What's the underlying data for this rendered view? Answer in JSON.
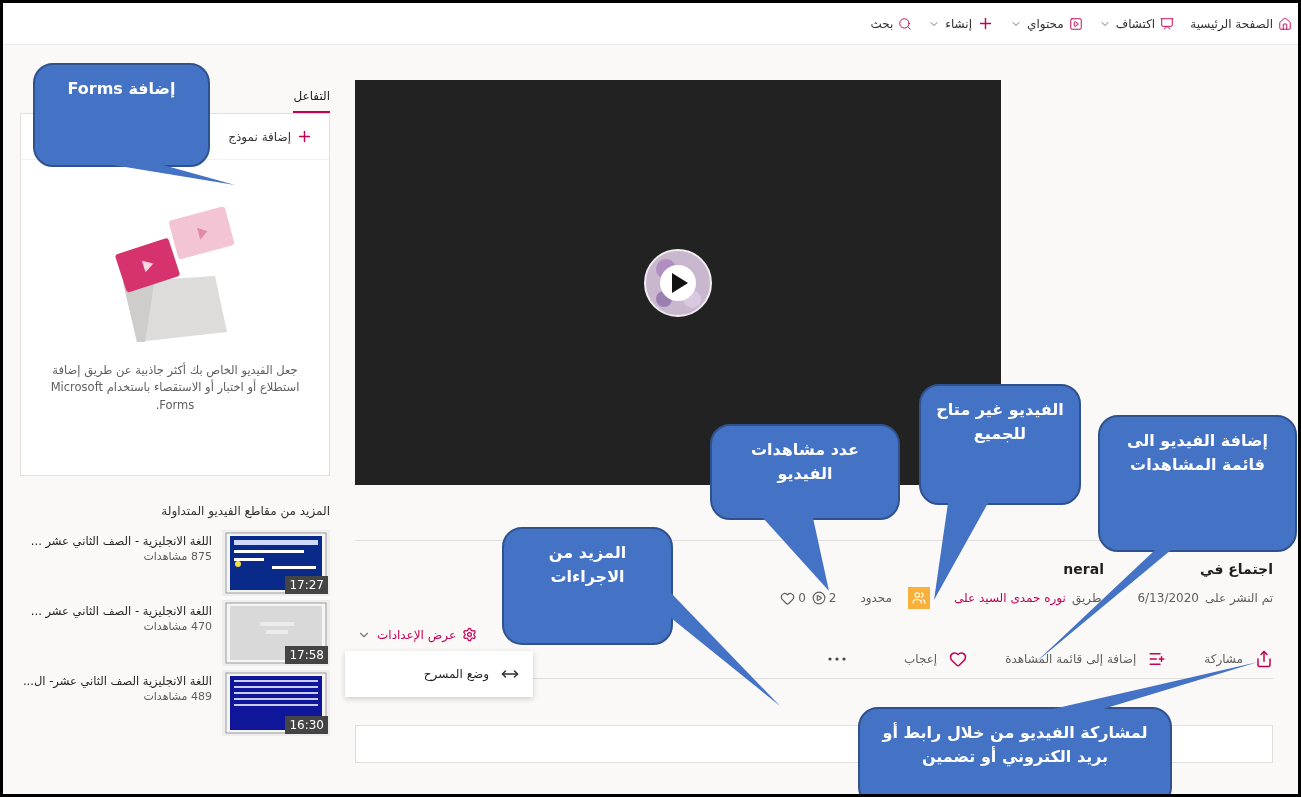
{
  "nav": [
    {
      "kind": "home",
      "label": "الصفحة الرئيسية",
      "dropdown": false
    },
    {
      "kind": "discover",
      "label": "اكتشاف",
      "dropdown": true
    },
    {
      "kind": "content",
      "label": "محتواي",
      "dropdown": true
    },
    {
      "kind": "create",
      "label": "إنشاء",
      "dropdown": true
    },
    {
      "kind": "search",
      "label": "بحث",
      "dropdown": false
    }
  ],
  "sidebar": {
    "tabs": [
      {
        "label": "التفاعل",
        "selected": true
      }
    ],
    "forms_card": {
      "add_button": "إضافة نموذج",
      "description": "جعل الفيديو الخاص بك أكثر جاذبية عن طريق إضافة استطلاع أو اختبار أو الاستقصاء باستخدام Microsoft Forms."
    },
    "trending": {
      "heading": "المزيد من مقاطع الفيديو المتداولة",
      "items": [
        {
          "kind": "navy-slide",
          "title": "اللغة الانجليزية - الصف الثاني عشر ...",
          "views": "875 مشاهدات",
          "duration": "17:27"
        },
        {
          "kind": "grey-slide",
          "title": "اللغة الانجليزية - الصف الثاني عشر ...",
          "views": "470 مشاهدات",
          "duration": "17:58"
        },
        {
          "kind": "text-slide",
          "title": "اللغة الانجليزية الصف الثاني عشر- ال...",
          "views": "489 مشاهدات",
          "duration": "16:30"
        }
      ]
    }
  },
  "video": {
    "title_fragments": [
      "اجتماع في",
      "neral"
    ],
    "posted_fragments": [
      "تم النشر على",
      "6/13/2020",
      "طريق"
    ],
    "author": "نوره حمدى السيد على",
    "privacy": "محدود",
    "views": "2",
    "likes": "0"
  },
  "settings": {
    "label": "عرض الإعدادات",
    "expanded": true,
    "menu": [
      {
        "label": "وضع المسرح"
      }
    ]
  },
  "actions": [
    {
      "kind": "share",
      "label": "مشاركة"
    },
    {
      "kind": "playlist",
      "label": "إضافة إلى قائمة المشاهدة"
    },
    {
      "kind": "like",
      "label": "إعجاب"
    },
    {
      "kind": "more"
    }
  ],
  "annotations": [
    {
      "text": "إضافة   Forms"
    },
    {
      "text": "عدد مشاهدات الفيديو"
    },
    {
      "text": "الفيديو غير متاح للجميع"
    },
    {
      "text": "إضافة الفيديو الى قائمة المشاهدات"
    },
    {
      "text": "المزيد من الاجراءات"
    },
    {
      "text": "لمشاركة الفيديو من خلال رابط أو بريد الكتروني أو تضمين"
    }
  ]
}
